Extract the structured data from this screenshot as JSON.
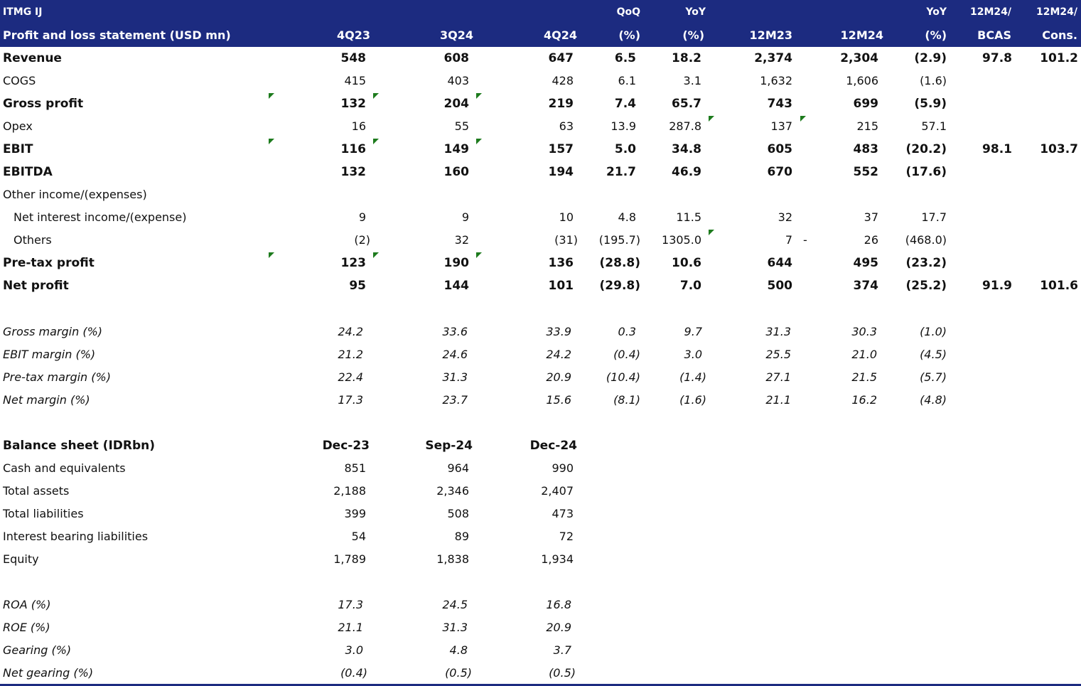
{
  "header": {
    "ticker": "ITMG IJ",
    "table_title": "Profit and loss statement (USD mn)",
    "columns": {
      "c1": {
        "top": "",
        "bottom": "4Q23"
      },
      "c2": {
        "top": "",
        "bottom": "3Q24"
      },
      "c3": {
        "top": "",
        "bottom": "4Q24"
      },
      "c4": {
        "top": "QoQ",
        "bottom": "(%)"
      },
      "c5": {
        "top": "YoY",
        "bottom": "(%)"
      },
      "c6": {
        "top": "",
        "bottom": "12M23"
      },
      "c7": {
        "top": "",
        "bottom": "12M24"
      },
      "c8": {
        "top": "YoY",
        "bottom": "(%)"
      },
      "c9": {
        "top": "12M24/",
        "bottom": "BCAS"
      },
      "c10": {
        "top": "12M24/",
        "bottom": "Cons."
      }
    }
  },
  "pnl": {
    "revenue": {
      "label": "Revenue",
      "c1": "548",
      "c2": "608",
      "c3": "647",
      "c4": "6.5",
      "c5": "18.2",
      "c6": "2,374",
      "c7": "2,304",
      "c8": "(2.9)",
      "c9": "97.8",
      "c10": "101.2"
    },
    "cogs": {
      "label": "COGS",
      "c1": "415",
      "c2": "403",
      "c3": "428",
      "c4": "6.1",
      "c5": "3.1",
      "c6": "1,632",
      "c7": "1,606",
      "c8": "(1.6)"
    },
    "gross_profit": {
      "label": "Gross profit",
      "c1": "132",
      "c2": "204",
      "c3": "219",
      "c4": "7.4",
      "c5": "65.7",
      "c6": "743",
      "c7": "699",
      "c8": "(5.9)"
    },
    "opex": {
      "label": "Opex",
      "c1": "16",
      "c2": "55",
      "c3": "63",
      "c4": "13.9",
      "c5": "287.8",
      "c6": "137",
      "c7": "215",
      "c8": "57.1"
    },
    "ebit": {
      "label": "EBIT",
      "c1": "116",
      "c2": "149",
      "c3": "157",
      "c4": "5.0",
      "c5": "34.8",
      "c6": "605",
      "c7": "483",
      "c8": "(20.2)",
      "c9": "98.1",
      "c10": "103.7"
    },
    "ebitda": {
      "label": "EBITDA",
      "c1": "132",
      "c2": "160",
      "c3": "194",
      "c4": "21.7",
      "c5": "46.9",
      "c6": "670",
      "c7": "552",
      "c8": "(17.6)"
    },
    "other_income": {
      "label": "Other income/(expenses)"
    },
    "net_interest": {
      "label": "Net interest income/(expense)",
      "c1": "9",
      "c2": "9",
      "c3": "10",
      "c4": "4.8",
      "c5": "11.5",
      "c6": "32",
      "c7": "37",
      "c8": "17.7"
    },
    "others": {
      "label": "Others",
      "c1": "(2)",
      "c2": "32",
      "c3": "(31)",
      "c4": "(195.7)",
      "c5": "1305.0",
      "c6": "7",
      "dash": "-",
      "c7": "26",
      "c8": "(468.0)"
    },
    "pretax": {
      "label": "Pre-tax profit",
      "c1": "123",
      "c2": "190",
      "c3": "136",
      "c4": "(28.8)",
      "c5": "10.6",
      "c6": "644",
      "c7": "495",
      "c8": "(23.2)"
    },
    "net_profit": {
      "label": "Net profit",
      "c1": "95",
      "c2": "144",
      "c3": "101",
      "c4": "(29.8)",
      "c5": "7.0",
      "c6": "500",
      "c7": "374",
      "c8": "(25.2)",
      "c9": "91.9",
      "c10": "101.6"
    }
  },
  "margins": {
    "gross": {
      "label": "Gross margin (%)",
      "c1": "24.2",
      "c2": "33.6",
      "c3": "33.9",
      "c4": "0.3",
      "c5": "9.7",
      "c6": "31.3",
      "c7": "30.3",
      "c8": "(1.0)"
    },
    "ebit": {
      "label": "EBIT margin (%)",
      "c1": "21.2",
      "c2": "24.6",
      "c3": "24.2",
      "c4": "(0.4)",
      "c5": "3.0",
      "c6": "25.5",
      "c7": "21.0",
      "c8": "(4.5)"
    },
    "pretax": {
      "label": "Pre-tax margin (%)",
      "c1": "22.4",
      "c2": "31.3",
      "c3": "20.9",
      "c4": "(10.4)",
      "c5": "(1.4)",
      "c6": "27.1",
      "c7": "21.5",
      "c8": "(5.7)"
    },
    "net": {
      "label": "Net margin (%)",
      "c1": "17.3",
      "c2": "23.7",
      "c3": "15.6",
      "c4": "(8.1)",
      "c5": "(1.6)",
      "c6": "21.1",
      "c7": "16.2",
      "c8": "(4.8)"
    }
  },
  "balance": {
    "header": {
      "label": "Balance sheet (IDRbn)",
      "c1": "Dec-23",
      "c2": "Sep-24",
      "c3": "Dec-24"
    },
    "cash": {
      "label": "Cash and equivalents",
      "c1": "851",
      "c2": "964",
      "c3": "990"
    },
    "assets": {
      "label": "Total assets",
      "c1": "2,188",
      "c2": "2,346",
      "c3": "2,407"
    },
    "liabilities": {
      "label": "Total liabilities",
      "c1": "399",
      "c2": "508",
      "c3": "473"
    },
    "ibl": {
      "label": "Interest bearing liabilities",
      "c1": "54",
      "c2": "89",
      "c3": "72"
    },
    "equity": {
      "label": "Equity",
      "c1": "1,789",
      "c2": "1,838",
      "c3": "1,934"
    }
  },
  "ratios": {
    "roa": {
      "label": "ROA (%)",
      "c1": "17.3",
      "c2": "24.5",
      "c3": "16.8"
    },
    "roe": {
      "label": "ROE (%)",
      "c1": "21.1",
      "c2": "31.3",
      "c3": "20.9"
    },
    "gearing": {
      "label": "Gearing (%)",
      "c1": "3.0",
      "c2": "4.8",
      "c3": "3.7"
    },
    "net_gearing": {
      "label": "Net gearing (%)",
      "c1": "(0.4)",
      "c2": "(0.5)",
      "c3": "(0.5)"
    }
  },
  "colors": {
    "header_bg": "#1c2b80",
    "header_text": "#ffffff",
    "flag": "#1d7b1d"
  }
}
